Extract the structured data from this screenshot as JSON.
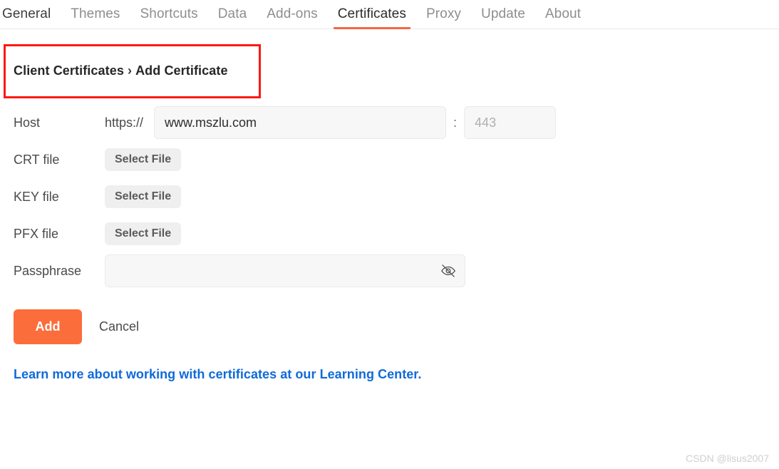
{
  "tabs": [
    {
      "label": "General",
      "state": "dark"
    },
    {
      "label": "Themes",
      "state": "normal"
    },
    {
      "label": "Shortcuts",
      "state": "normal"
    },
    {
      "label": "Data",
      "state": "normal"
    },
    {
      "label": "Add-ons",
      "state": "normal"
    },
    {
      "label": "Certificates",
      "state": "active"
    },
    {
      "label": "Proxy",
      "state": "normal"
    },
    {
      "label": "Update",
      "state": "normal"
    },
    {
      "label": "About",
      "state": "normal"
    }
  ],
  "breadcrumb": {
    "parent": "Client Certificates",
    "separator": "›",
    "current": "Add Certificate"
  },
  "annotation": {
    "color": "#fa1a12"
  },
  "form": {
    "host": {
      "label": "Host",
      "scheme": "https://",
      "value": "www.mszlu.com",
      "placeholder": "",
      "colon": ":",
      "port_value": "",
      "port_placeholder": "443"
    },
    "crt": {
      "label": "CRT file",
      "button": "Select File"
    },
    "key": {
      "label": "KEY file",
      "button": "Select File"
    },
    "pfx": {
      "label": "PFX file",
      "button": "Select File"
    },
    "passphrase": {
      "label": "Passphrase",
      "value": "",
      "placeholder": "",
      "toggle_icon": "eye-off-icon"
    }
  },
  "actions": {
    "add_label": "Add",
    "cancel_label": "Cancel",
    "add_color": "#fb6d3a"
  },
  "learn_more": {
    "text": "Learn more about working with certificates at our Learning Center.",
    "color": "#0f6ada"
  },
  "watermark": {
    "text": "CSDN @lisus2007"
  }
}
